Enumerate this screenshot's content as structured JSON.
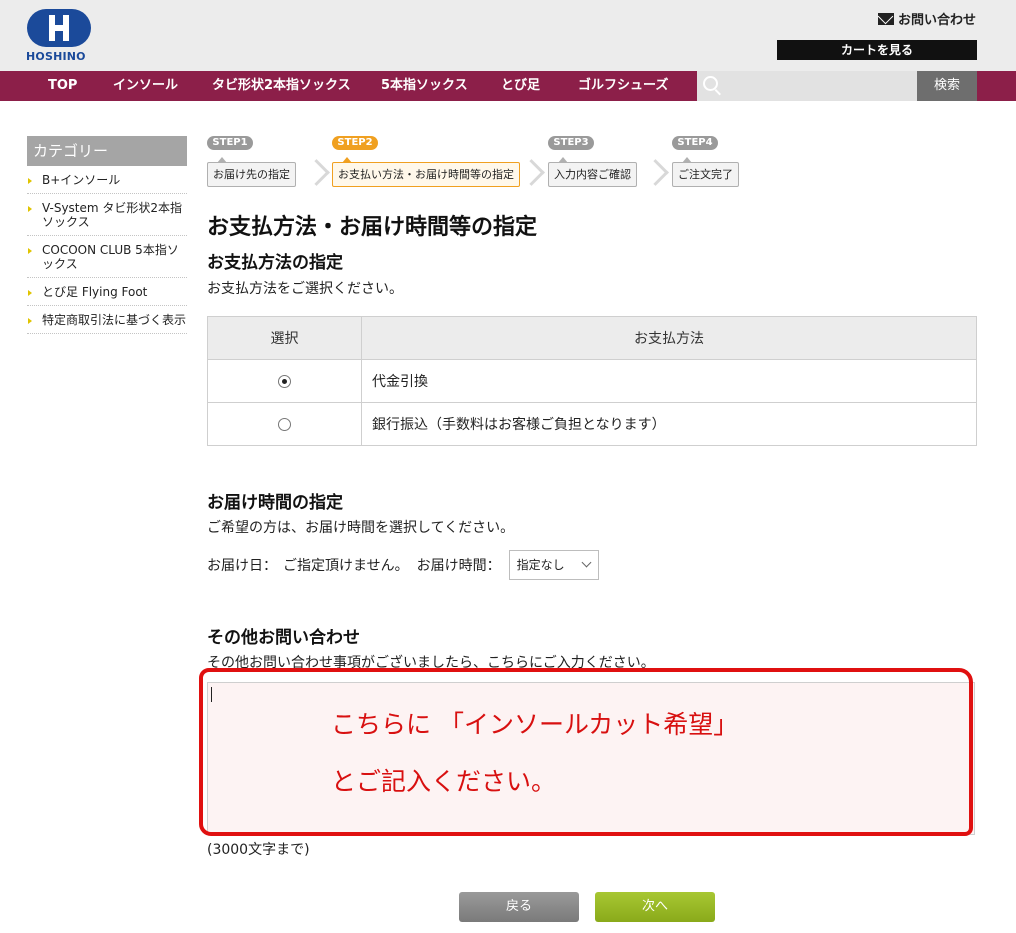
{
  "header": {
    "logo_text": "HOSHINO",
    "contact_label": "お問い合わせ",
    "cart_label": "カートを見る"
  },
  "nav": {
    "items": [
      "TOP",
      "インソール",
      "タビ形状2本指ソックス",
      "5本指ソックス",
      "とび足",
      "ゴルフシューズ"
    ],
    "search_placeholder": "",
    "search_button": "検索"
  },
  "sidebar": {
    "title": "カテゴリー",
    "items": [
      "B+インソール",
      "V-System タビ形状2本指ソックス",
      "COCOON CLUB 5本指ソックス",
      "とび足 Flying Foot",
      "特定商取引法に基づく表示"
    ]
  },
  "steps": [
    {
      "badge": "STEP1",
      "label": "お届け先の指定",
      "active": false
    },
    {
      "badge": "STEP2",
      "label": "お支払い方法・お届け時間等の指定",
      "active": true
    },
    {
      "badge": "STEP3",
      "label": "入力内容ご確認",
      "active": false
    },
    {
      "badge": "STEP4",
      "label": "ご注文完了",
      "active": false
    }
  ],
  "main": {
    "title": "お支払方法・お届け時間等の指定",
    "payment": {
      "heading": "お支払方法の指定",
      "instruction": "お支払方法をご選択ください。",
      "col_select": "選択",
      "col_method": "お支払方法",
      "rows": [
        {
          "label": "代金引換",
          "checked": true
        },
        {
          "label": "銀行振込（手数料はお客様ご負担となります）",
          "checked": false
        }
      ]
    },
    "delivery": {
      "heading": "お届け時間の指定",
      "instruction": "ご希望の方は、お届け時間を選択してください。",
      "date_label": "お届け日：",
      "date_value": "ご指定頂けません。",
      "time_label": "お届け時間：",
      "time_selected": "指定なし"
    },
    "inquiry": {
      "heading": "その他お問い合わせ",
      "instruction": "その他お問い合わせ事項がございましたら、こちらにご入力ください。",
      "limit_note": "(3000文字まで)",
      "annotation_line1": "こちらに 「インソールカット希望」",
      "annotation_line2": "とご記入ください。"
    },
    "buttons": {
      "back": "戻る",
      "next": "次へ"
    }
  },
  "colors": {
    "nav_bg": "#8c1f49",
    "brand_blue": "#1b4a9a",
    "step_active": "#f0a020",
    "step_inactive": "#9a9a9a",
    "annotation_red": "#e01010",
    "next_green": "#9ab926"
  }
}
